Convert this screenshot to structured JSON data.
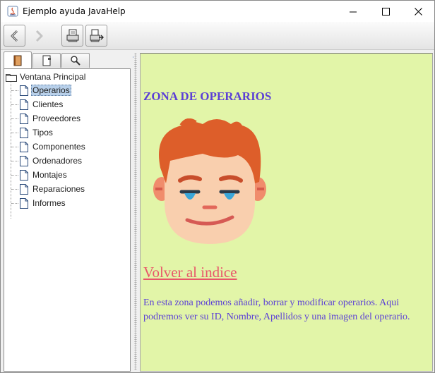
{
  "window": {
    "title": "Ejemplo ayuda JavaHelp"
  },
  "toolbar": {
    "buttons": [
      "back-icon",
      "forward-icon",
      "print-icon",
      "page-setup-icon"
    ]
  },
  "navigator": {
    "tabs": [
      "toc-icon",
      "index-icon",
      "search-icon"
    ],
    "root_label": "Ventana Principal",
    "items": [
      {
        "label": "Operarios"
      },
      {
        "label": "Clientes"
      },
      {
        "label": "Proveedores"
      },
      {
        "label": "Tipos"
      },
      {
        "label": "Componentes"
      },
      {
        "label": "Ordenadores"
      },
      {
        "label": "Montajes"
      },
      {
        "label": "Reparaciones"
      },
      {
        "label": "Informes"
      }
    ],
    "selected": "Operarios"
  },
  "content": {
    "heading": "ZONA DE OPERARIOS",
    "link": "Volver al indice",
    "description": "En esta zona podemos añadir, borrar y modificar operarios. Aqui podremos ver su ID, Nombre, Apellidos y una imagen del operario.",
    "colors": {
      "background": "#e2f5a8",
      "heading": "#5b3fd6",
      "link": "#e8576a"
    }
  }
}
